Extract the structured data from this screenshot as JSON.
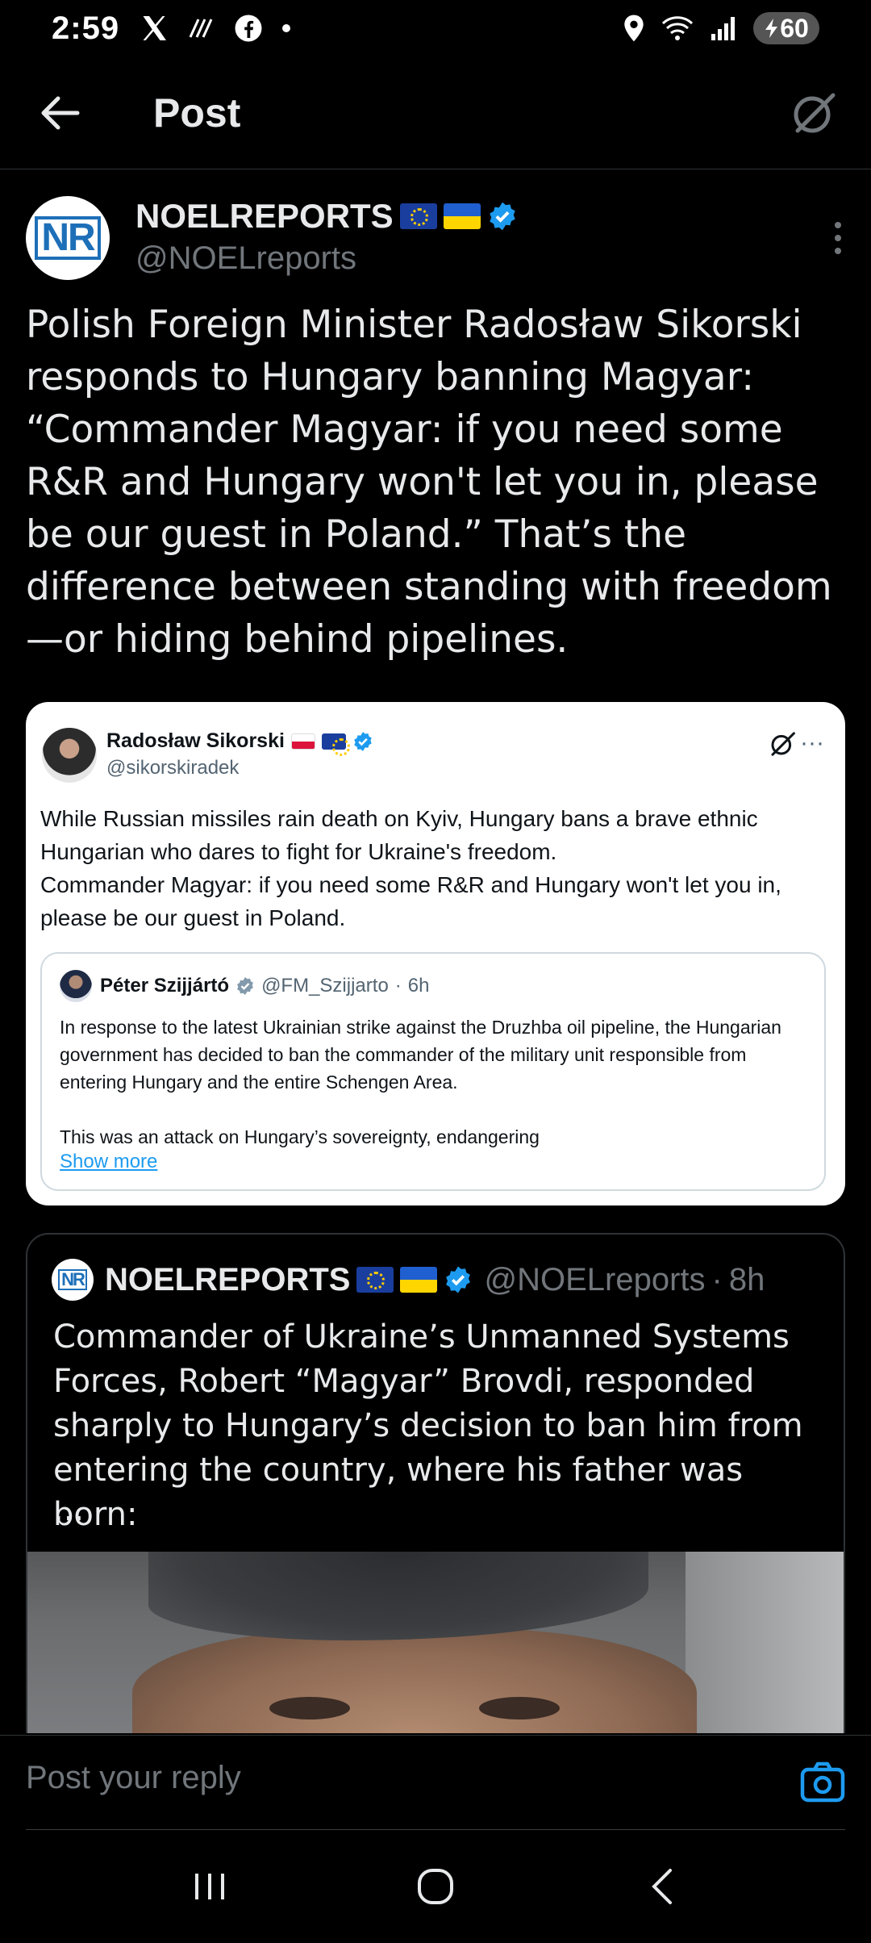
{
  "status_bar": {
    "time": "2:59",
    "battery": "60"
  },
  "header": {
    "title": "Post"
  },
  "post": {
    "author_name": "NOELREPORTS",
    "author_handle": "@NOELreports",
    "text": "Polish Foreign Minister Radosław Sikorski responds to Hungary banning Magyar: “Commander Magyar: if you need some R&R and Hungary won't let you in, please be our guest in Poland.” That’s the difference between standing with freedom—or hiding behind pipelines."
  },
  "embed": {
    "author_name": "Radosław Sikorski",
    "author_handle": "@sikorskiradek",
    "text": "While Russian missiles rain death on Kyiv, Hungary bans a brave ethnic Hungarian who dares to fight for Ukraine's freedom.\nCommander Magyar: if you need some R&R and Hungary won't let you in, please be our guest in Poland.",
    "quote": {
      "author_name": "Péter Szijjártó",
      "author_handle": "@FM_Szijjarto",
      "time": "6h",
      "text": "In response to the latest Ukrainian strike against the Druzhba oil pipeline, the Hungarian government has decided to ban the commander of the military unit responsible from entering Hungary and the entire Schengen Area.\n\nThis was an attack on Hungary’s sovereignty, endangering",
      "show_more": "Show more"
    }
  },
  "quoted_post": {
    "author_name": "NOELREPORTS",
    "author_handle": "@NOELreports",
    "time": "8h",
    "text": "Commander of Ukraine’s Unmanned Systems Forces, Robert “Magyar” Brovdi, responded sharply to Hungary’s decision to ban him from entering the country, where his father was born:",
    "ellipsis": "..."
  },
  "reply": {
    "placeholder": "Post your reply"
  },
  "colors": {
    "accent": "#1d9bf0",
    "background": "#000000",
    "secondary_text": "#71767b"
  }
}
